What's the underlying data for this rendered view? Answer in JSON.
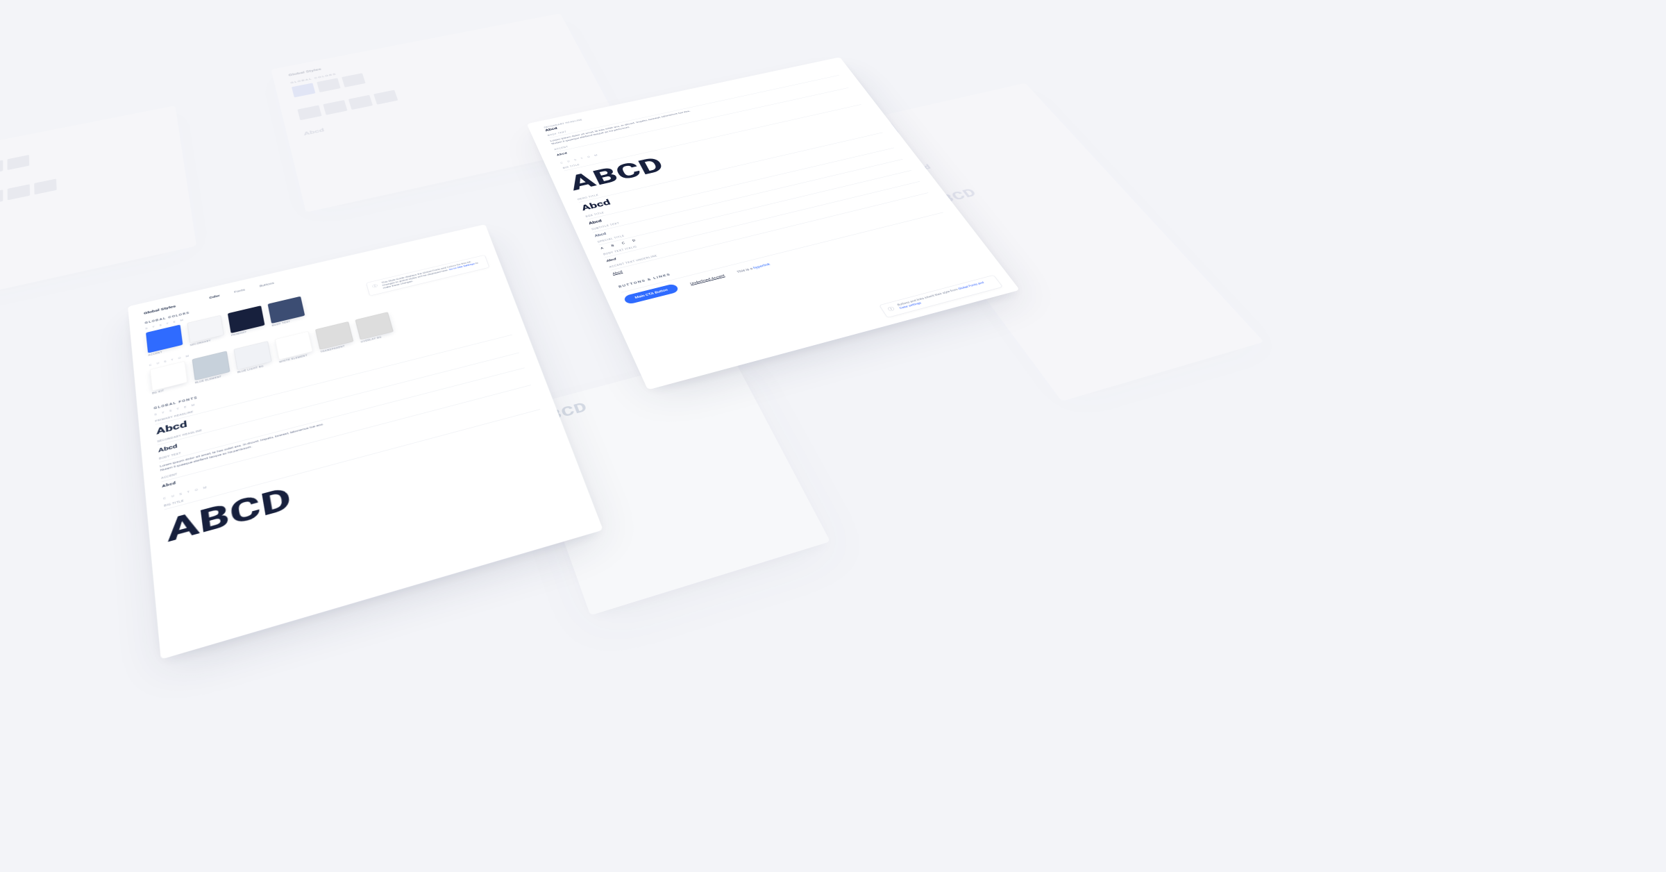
{
  "page_title": "Global Styles",
  "tabs": {
    "color": "Color",
    "fonts": "Fonts",
    "buttons": "Buttons"
  },
  "sections": {
    "global_colors": "GLOBAL COLORS",
    "global_fonts": "GLOBAL FONTS",
    "buttons_links": "BUTTONS & LINKS",
    "system": "S Y S T E M",
    "custom": "C U S T O M"
  },
  "callout_colors": {
    "text_a": "This Style Guide displays the Global Fonts and Colors for this kit. Changes to global styles will be displayed here. ",
    "link": "Go to Site Settings",
    "text_b": " to make these changes."
  },
  "callout_buttons": {
    "text": "Buttons and links inherit their style from ",
    "link": "Global Fonts and Color settings"
  },
  "colors_system": [
    {
      "name": "ACCENT",
      "hex": "#2f6bff"
    },
    {
      "name": "SECONDARY",
      "hex": "#f4f5f8"
    },
    {
      "name": "PRIMARY",
      "hex": "#17203d"
    },
    {
      "name": "BODY TEXT",
      "hex": "#3c4d73"
    }
  ],
  "colors_custom": [
    {
      "name": "BG KIT",
      "hex": "#ffffff"
    },
    {
      "name": "BLUE ELEMENT",
      "hex": "#c7d1db"
    },
    {
      "name": "BLUE LIGHT BG",
      "hex": "#f0f2f6"
    },
    {
      "name": "WHITE ELEMENT",
      "hex": "#ffffff"
    },
    {
      "name": "TRANSPARENT",
      "pattern": "checker"
    },
    {
      "name": "OVERLAY BG",
      "pattern": "darkchecker"
    }
  ],
  "fonts_system": {
    "primary_label": "PRIMARY HEADLINE",
    "primary_sample": "Abcd",
    "secondary_label": "SECONDARY HEADLINE",
    "secondary_sample": "Abcd",
    "body_label": "BODY TEXT",
    "body_sample": "Lorem ipsum dolor sit amet, te has solet ans. In dicunt. Impetu, lorerest, laboramus tue eos. Nuiam li quaeque eleifend laoque ac ha periissum.",
    "accent_label": "ACCENT",
    "accent_sample": "Abcd"
  },
  "fonts_custom": {
    "big_label": "BIG TITLE",
    "big_sample": "ABCD",
    "hero_label": "HERO TITLE",
    "hero_sample": "Abcd",
    "box_label": "BOX TITLE",
    "box_sample": "Abcd",
    "subtitle_label": "SUBTITLE TEXT",
    "subtitle_sample": "Abcd",
    "special_label": "SPECIAL TITLE",
    "special_sample": "A B C D",
    "italic_label": "BODY TEXT ITALIC",
    "italic_sample": "Abcd",
    "under_label": "ACCENT TEXT UNDERLINE",
    "under_sample": "Abcd"
  },
  "buttons": {
    "cta": "Main CTA Button",
    "underlined": "Underlined Accent",
    "text_link": "This is a ",
    "text_link_a": "hyperlink"
  }
}
